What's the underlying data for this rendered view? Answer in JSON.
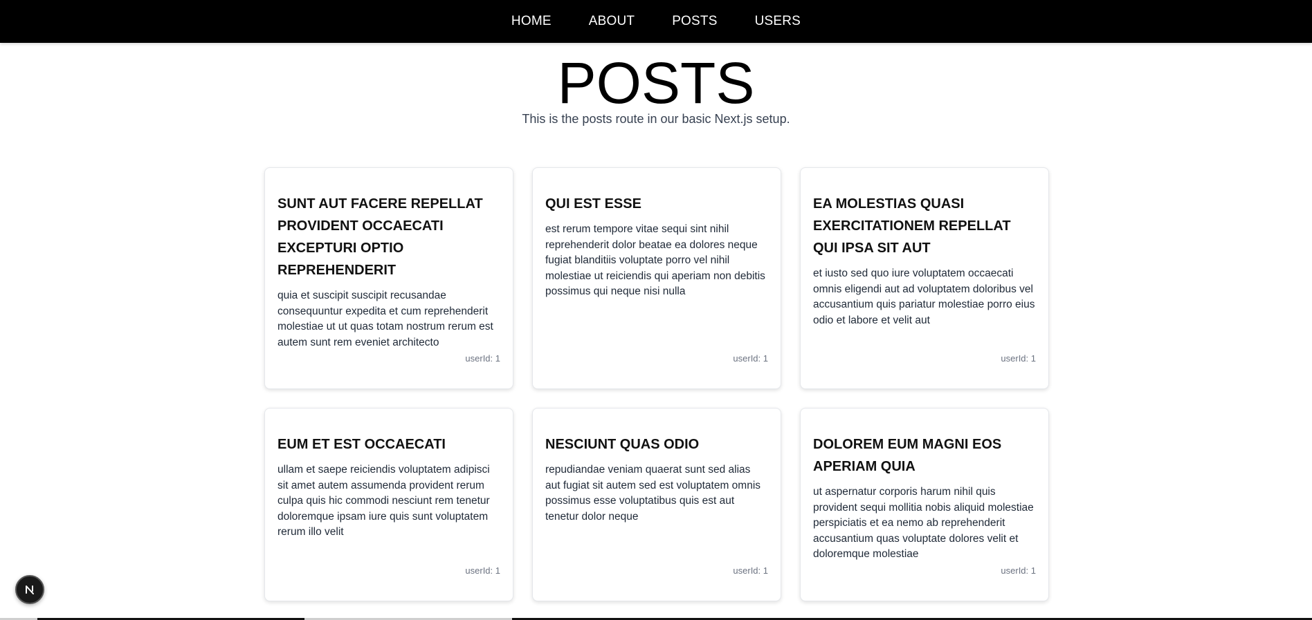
{
  "nav": {
    "items": [
      {
        "label": "HOME"
      },
      {
        "label": "ABOUT"
      },
      {
        "label": "POSTS"
      },
      {
        "label": "USERS"
      }
    ]
  },
  "header": {
    "title": "POSTS",
    "subtitle": "This is the posts route in our basic Next.js setup."
  },
  "posts": [
    {
      "title": "sunt aut facere repellat provident occaecati excepturi optio reprehenderit",
      "body": "quia et suscipit suscipit recusandae consequuntur expedita et cum reprehenderit molestiae ut ut quas totam nostrum rerum est autem sunt rem eveniet architecto",
      "user": "userId: 1"
    },
    {
      "title": "qui est esse",
      "body": "est rerum tempore vitae sequi sint nihil reprehenderit dolor beatae ea dolores neque fugiat blanditiis voluptate porro vel nihil molestiae ut reiciendis qui aperiam non debitis possimus qui neque nisi nulla",
      "user": "userId: 1"
    },
    {
      "title": "ea molestias quasi exercitationem repellat qui ipsa sit aut",
      "body": "et iusto sed quo iure voluptatem occaecati omnis eligendi aut ad voluptatem doloribus vel accusantium quis pariatur molestiae porro eius odio et labore et velit aut",
      "user": "userId: 1"
    },
    {
      "title": "eum et est occaecati",
      "body": "ullam et saepe reiciendis voluptatem adipisci sit amet autem assumenda provident rerum culpa quis hic commodi nesciunt rem tenetur doloremque ipsam iure quis sunt voluptatem rerum illo velit",
      "user": "userId: 1"
    },
    {
      "title": "nesciunt quas odio",
      "body": "repudiandae veniam quaerat sunt sed alias aut fugiat sit autem sed est voluptatem omnis possimus esse voluptatibus quis est aut tenetur dolor neque",
      "user": "userId: 1"
    },
    {
      "title": "dolorem eum magni eos aperiam quia",
      "body": "ut aspernatur corporis harum nihil quis provident sequi mollitia nobis aliquid molestiae perspiciatis et ea nemo ab reprehenderit accusantium quas voluptate dolores velit et doloremque molestiae",
      "user": "userId: 1"
    }
  ],
  "badge": {
    "letter": "N",
    "icon": "nextjs-logo-icon"
  },
  "colors": {
    "navbar": "#000000",
    "nav_text": "#ffffff",
    "card_border": "#e5e7eb",
    "meta_text": "#6b7280"
  }
}
